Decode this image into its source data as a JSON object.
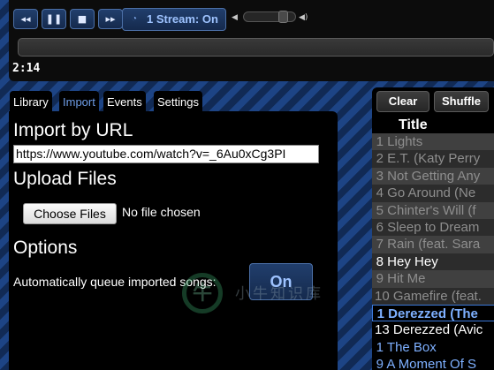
{
  "player": {
    "prev_icon": "skip-back-icon",
    "pause_icon": "pause-icon",
    "stop_icon": "stop-icon",
    "next_icon": "skip-forward-icon",
    "prev_glyph": "◂◂",
    "pause_glyph": "❚❚",
    "stop_glyph": "■",
    "next_glyph": "▸▸",
    "stream_icon": "rss-icon",
    "stream_glyph": "◔",
    "stream_label": "1 Stream: On",
    "volume_low_glyph": "◀",
    "volume_high_glyph": "◀)",
    "volume_level": 0.82,
    "elapsed": "2:14",
    "progress": 0
  },
  "tabs": [
    {
      "label": "Library"
    },
    {
      "label": "Import"
    },
    {
      "label": "Events"
    },
    {
      "label": "Settings"
    }
  ],
  "active_tab": "Import",
  "import": {
    "heading": "Import by URL",
    "url_value": "https://www.youtube.com/watch?v=_6Au0xCg3PI",
    "upload_heading": "Upload Files",
    "choose_files_label": "Choose Files",
    "no_file_text": "No file chosen",
    "options_heading": "Options",
    "auto_queue_label": "Automatically queue imported songs:",
    "auto_queue_value": "On"
  },
  "watermark": {
    "logo_text": "牛",
    "text": "小牛知识库"
  },
  "queue": {
    "clear_label": "Clear",
    "shuffle_label": "Shuffle",
    "column_title": "Title",
    "rows": [
      {
        "num": "1",
        "title": "Lights",
        "state": "played"
      },
      {
        "num": "2",
        "title": "E.T. (Katy Perry",
        "state": "played"
      },
      {
        "num": "3",
        "title": "Not Getting Any",
        "state": "played"
      },
      {
        "num": "4",
        "title": "Go Around (Ne",
        "state": "played"
      },
      {
        "num": "5",
        "title": "Chinter's Will (f",
        "state": "played"
      },
      {
        "num": "6",
        "title": "Sleep to Dream",
        "state": "played"
      },
      {
        "num": "7",
        "title": "Rain (feat. Sara",
        "state": "played"
      },
      {
        "num": "8",
        "title": "Hey Hey",
        "state": "unplayed"
      },
      {
        "num": "9",
        "title": "Hit Me",
        "state": "played"
      },
      {
        "num": "10",
        "title": "Gamefire (feat.",
        "state": "played"
      },
      {
        "num": "1",
        "title": "Derezzed (The",
        "state": "current"
      },
      {
        "num": "13",
        "title": "Derezzed (Avic",
        "state": "queued"
      },
      {
        "num": "1",
        "title": "The Box",
        "state": "upcoming"
      },
      {
        "num": "9",
        "title": "A Moment Of S",
        "state": "upcoming"
      }
    ]
  }
}
